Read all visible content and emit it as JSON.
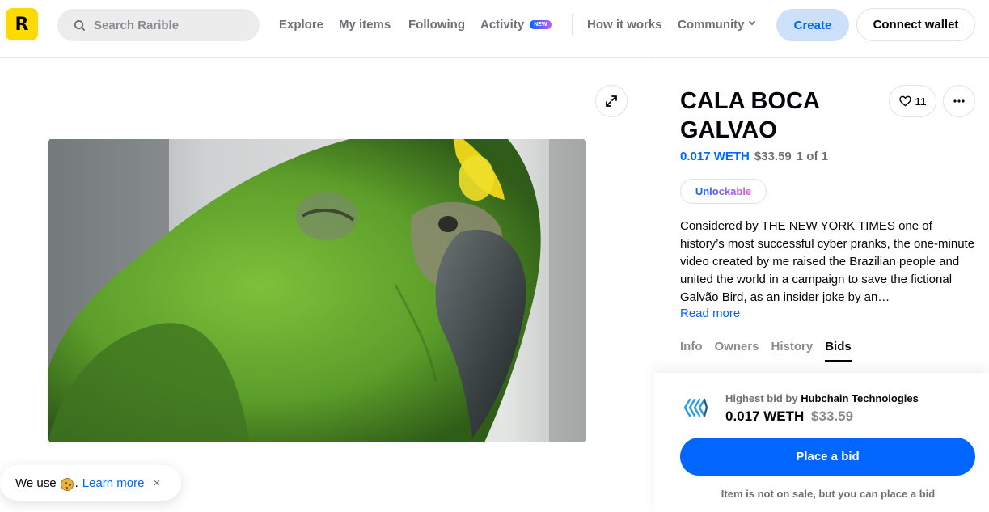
{
  "header": {
    "logo_letter": "R",
    "search_placeholder": "Search Rarible",
    "nav": {
      "explore": "Explore",
      "my_items": "My items",
      "following": "Following",
      "activity": "Activity",
      "new_badge": "NEW",
      "how_it_works": "How it works",
      "community": "Community"
    },
    "create_label": "Create",
    "connect_wallet_label": "Connect wallet"
  },
  "item": {
    "title": "CALA BOCA GALVAO",
    "likes": "11",
    "price_weth": "0.017 WETH",
    "price_usd": "$33.59",
    "edition": "1 of 1",
    "unlockable_label": "Unlockable",
    "description": "Considered by THE NEW YORK TIMES one of history’s most successful cyber pranks, the one-minute video created by me raised the Brazilian people and united the world in a campaign to save the fictional Galvão Bird, as an insider joke by an…",
    "read_more": "Read more",
    "tabs": [
      "Info",
      "Owners",
      "History",
      "Bids"
    ],
    "active_tab": "Bids"
  },
  "bid": {
    "prefix": "Highest bid by",
    "bidder": "Hubchain Technologies",
    "amount": "0.017 WETH",
    "amount_usd": "$33.59",
    "button_label": "Place a bid",
    "note": "Item is not on sale, but you can place a bid"
  },
  "cookie": {
    "text": "We use",
    "link": "Learn more",
    "close": "×"
  },
  "colors": {
    "accent": "#0066ff",
    "logo": "#feda03",
    "create_bg": "#cde0fa"
  }
}
